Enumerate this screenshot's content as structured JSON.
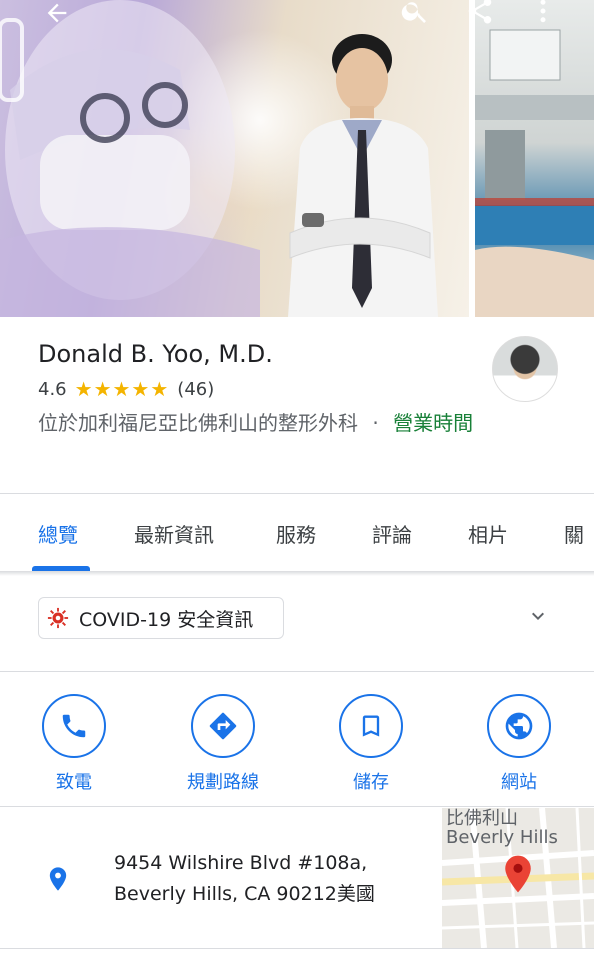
{
  "place": {
    "name": "Donald B. Yoo, M.D.",
    "rating": "4.6",
    "stars": "★★★★★",
    "review_count": "(46)",
    "category": "位於加利福尼亞比佛利山的整形外科",
    "separator": "·",
    "hours_link": "營業時間"
  },
  "tabs": [
    {
      "label": "總覽"
    },
    {
      "label": "最新資訊"
    },
    {
      "label": "服務"
    },
    {
      "label": "評論"
    },
    {
      "label": "相片"
    },
    {
      "label": "關"
    }
  ],
  "covid": {
    "label": "COVID-19 安全資訊"
  },
  "actions": [
    {
      "label": "致電",
      "icon": "phone-icon"
    },
    {
      "label": "規劃路線",
      "icon": "directions-icon"
    },
    {
      "label": "儲存",
      "icon": "bookmark-icon"
    },
    {
      "label": "網站",
      "icon": "globe-icon"
    }
  ],
  "address": {
    "line1": "9454 Wilshire Blvd #108a,",
    "line2": "Beverly Hills, CA 90212美國"
  },
  "map": {
    "label_zh": "比佛利山",
    "label_en": "Beverly Hills"
  },
  "colors": {
    "accent": "#1a73e8",
    "star": "#f4b400",
    "open_green": "#188038",
    "pin_red": "#ea4335"
  }
}
